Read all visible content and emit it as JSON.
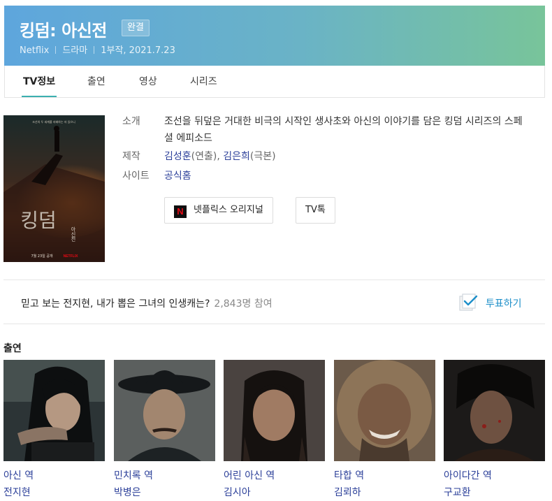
{
  "header": {
    "title": "킹덤: 아신전",
    "badge": "완결",
    "meta": [
      "Netflix",
      "드라마",
      "1부작, 2021.7.23"
    ]
  },
  "tabs": [
    {
      "label": "TV정보",
      "active": true
    },
    {
      "label": "출연",
      "active": false
    },
    {
      "label": "영상",
      "active": false
    },
    {
      "label": "시리즈",
      "active": false
    }
  ],
  "poster": {
    "tagline": "조선의 두 세계를 지배하는 자 있으니",
    "title": "킹덤",
    "subtitle": "아신전",
    "footer": "7월 23일 공개",
    "brand": "NETFLIX"
  },
  "info": {
    "intro_label": "소개",
    "intro_text": "조선을 뒤덮은 거대한 비극의 시작인 생사초와 아신의 이야기를 담은 킹덤 시리즈의 스페셜 에피소드",
    "production_label": "제작",
    "director": "김성훈",
    "director_role": "(연출),",
    "writer": "김은희",
    "writer_role": "(극본)",
    "site_label": "사이트",
    "site_link": "공식홈"
  },
  "chips": {
    "netflix_icon": "N",
    "netflix_original": "넷플릭스 오리지널",
    "tv_talk": "TV톡"
  },
  "poll": {
    "question": "믿고 보는 전지현, 내가 뽑은 그녀의 인생캐는?",
    "count": "2,843명 참여",
    "vote_label": "투표하기"
  },
  "cast": {
    "heading": "출연",
    "members": [
      {
        "role": "아신 역",
        "name": "전지현"
      },
      {
        "role": "민치록 역",
        "name": "박병은"
      },
      {
        "role": "어린 아신 역",
        "name": "김시아"
      },
      {
        "role": "타합 역",
        "name": "김뢰하"
      },
      {
        "role": "아이다간 역",
        "name": "구교환"
      }
    ]
  },
  "colors": {
    "header_gradient_start": "#5ea6dd",
    "header_gradient_end": "#78c49a",
    "link": "#2b3f99",
    "vote": "#1d8fc9",
    "tab_underline": "#3cb0b0"
  }
}
